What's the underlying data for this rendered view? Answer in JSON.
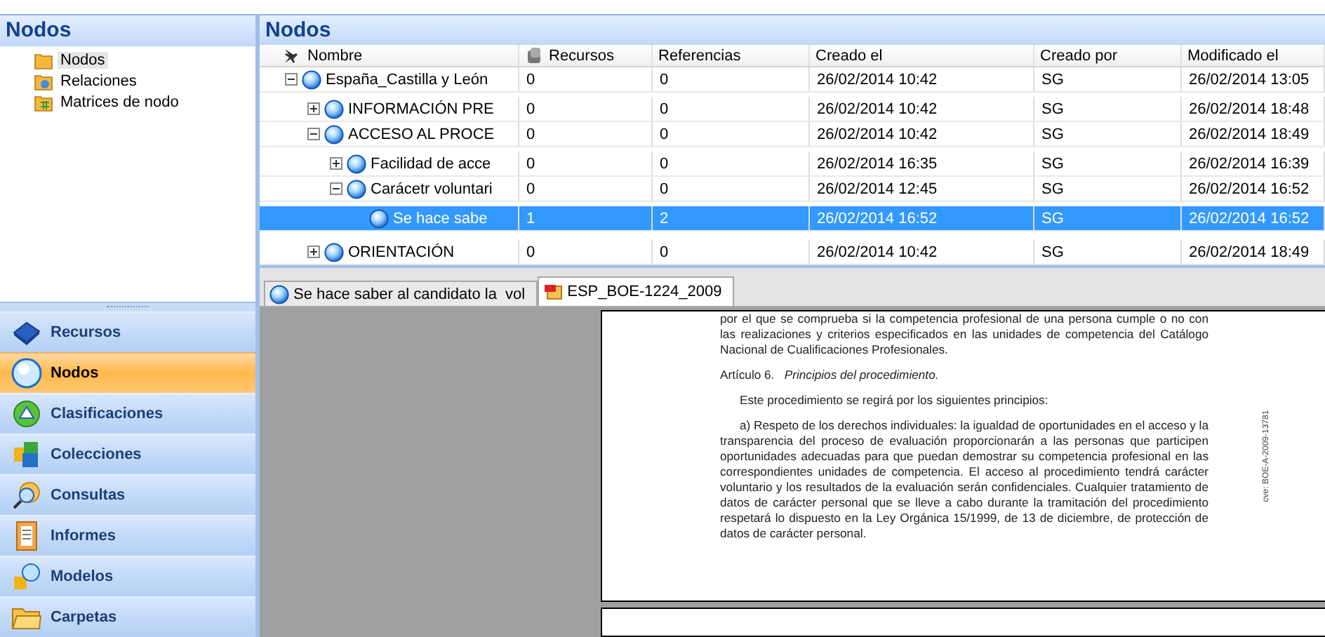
{
  "sidebar": {
    "title": "Nodos",
    "items": [
      {
        "label": "Nodos",
        "selected": true
      },
      {
        "label": "Relaciones",
        "selected": false
      },
      {
        "label": "Matrices de nodo",
        "selected": false
      }
    ]
  },
  "navigation": [
    {
      "label": "Recursos",
      "selected": false
    },
    {
      "label": "Nodos",
      "selected": true
    },
    {
      "label": "Clasificaciones",
      "selected": false
    },
    {
      "label": "Colecciones",
      "selected": false
    },
    {
      "label": "Consultas",
      "selected": false
    },
    {
      "label": "Informes",
      "selected": false
    },
    {
      "label": "Modelos",
      "selected": false
    },
    {
      "label": "Carpetas",
      "selected": false
    }
  ],
  "main": {
    "title": "Nodos",
    "table": {
      "columns": [
        "Nombre",
        "Recursos",
        "Referencias",
        "Creado el",
        "Creado por",
        "Modificado el"
      ],
      "rows": [
        {
          "name": "España_Castilla y León",
          "recursos": "0",
          "referencias": "0",
          "creado_el": "26/02/2014 10:42",
          "creado_por": "SG",
          "modificado_el": "26/02/2014 13:05",
          "selected": false,
          "expanded": true,
          "children": [
            {
              "name": "INFORMACIÓN PRE",
              "recursos": "0",
              "referencias": "0",
              "creado_el": "26/02/2014 10:42",
              "creado_por": "SG",
              "modificado_el": "26/02/2014 18:48",
              "selected": false,
              "expanded": false
            },
            {
              "name": "ACCESO AL PROCE",
              "recursos": "0",
              "referencias": "0",
              "creado_el": "26/02/2014 10:42",
              "creado_por": "SG",
              "modificado_el": "26/02/2014 18:49",
              "selected": false,
              "expanded": true,
              "children": [
                {
                  "name": "Facilidad de acce",
                  "recursos": "0",
                  "referencias": "0",
                  "creado_el": "26/02/2014 16:35",
                  "creado_por": "SG",
                  "modificado_el": "26/02/2014 16:39",
                  "selected": false,
                  "expanded": false
                },
                {
                  "name": "Carácetr voluntari",
                  "recursos": "0",
                  "referencias": "0",
                  "creado_el": "26/02/2014 12:45",
                  "creado_por": "SG",
                  "modificado_el": "26/02/2014 16:52",
                  "selected": false,
                  "expanded": true,
                  "children": [
                    {
                      "name": "Se hace sabe",
                      "recursos": "1",
                      "referencias": "2",
                      "creado_el": "26/02/2014 16:52",
                      "creado_por": "SG",
                      "modificado_el": "26/02/2014 16:52",
                      "selected": true
                    }
                  ]
                }
              ]
            },
            {
              "name": "ORIENTACIÓN",
              "recursos": "0",
              "referencias": "0",
              "creado_el": "26/02/2014 10:42",
              "creado_por": "SG",
              "modificado_el": "26/02/2014 18:49",
              "selected": false,
              "expanded": false
            }
          ]
        }
      ]
    }
  },
  "tabs": [
    {
      "label": "Se hace saber al candidato la  vol",
      "selected": false,
      "kind": "node"
    },
    {
      "label": "ESP_BOE-1224_2009",
      "selected": true,
      "kind": "pdf"
    }
  ],
  "document": {
    "paragraphs": [
      {
        "kind": "body",
        "text": "por el que se comprueba si la competencia profesional de una persona cumple o no con las realizaciones y criterios especificados en las unidades de competencia del Catálogo Nacional de Cualificaciones Profesionales."
      },
      {
        "kind": "heading",
        "number": "Artículo 6.",
        "text": "Principios del procedimiento."
      },
      {
        "kind": "indent",
        "text": "Este procedimiento se regirá por los siguientes principios:"
      },
      {
        "kind": "indent",
        "text": "a)  Respeto de los derechos individuales: la igualdad de oportunidades en el acceso y la transparencia del proceso de evaluación proporcionarán a las personas que participen oportunidades adecuadas para que puedan demostrar su competencia profesional en las correspondientes unidades de competencia. El acceso al procedimiento tendrá carácter voluntario y los resultados de la evaluación serán confidenciales. Cualquier tratamiento de datos de carácter personal que se lleve a cabo durante la tramitación del procedimiento respetará lo dispuesto en la Ley Orgánica 15/1999, de 13 de diciembre, de protección de datos de carácter personal."
      }
    ],
    "side_note": "cve: BOE-A-2009-13781"
  }
}
